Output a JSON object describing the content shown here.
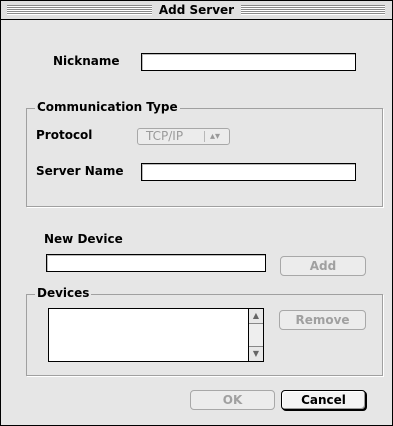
{
  "window": {
    "title": "Add Server"
  },
  "nickname": {
    "label": "Nickname",
    "value": ""
  },
  "communication": {
    "group_title": "Communication Type",
    "protocol_label": "Protocol",
    "protocol_value": "TCP/IP",
    "popup_arrows": "▴▾",
    "server_name_label": "Server Name",
    "server_name_value": ""
  },
  "new_device": {
    "label": "New Device",
    "value": "",
    "add_label": "Add"
  },
  "devices": {
    "group_title": "Devices",
    "remove_label": "Remove",
    "scroll_up": "▲",
    "scroll_down": "▼"
  },
  "footer": {
    "ok_label": "OK",
    "cancel_label": "Cancel"
  }
}
